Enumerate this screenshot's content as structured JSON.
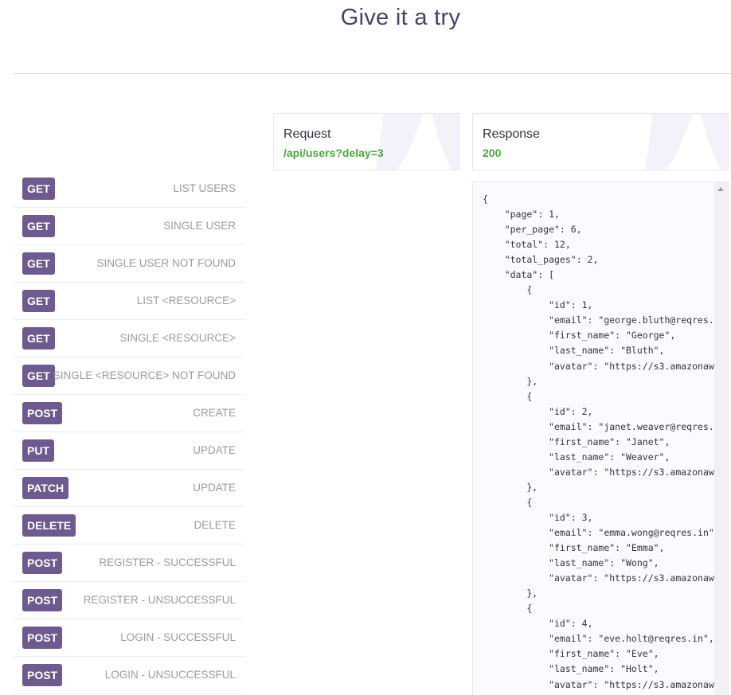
{
  "header": {
    "title": "Give it a try"
  },
  "endpoints": [
    {
      "method": "GET",
      "label": "LIST USERS"
    },
    {
      "method": "GET",
      "label": "SINGLE USER"
    },
    {
      "method": "GET",
      "label": "SINGLE USER NOT FOUND"
    },
    {
      "method": "GET",
      "label": "LIST <RESOURCE>"
    },
    {
      "method": "GET",
      "label": "SINGLE <RESOURCE>"
    },
    {
      "method": "GET",
      "label": "SINGLE <RESOURCE> NOT FOUND"
    },
    {
      "method": "POST",
      "label": "CREATE"
    },
    {
      "method": "PUT",
      "label": "UPDATE"
    },
    {
      "method": "PATCH",
      "label": "UPDATE"
    },
    {
      "method": "DELETE",
      "label": "DELETE"
    },
    {
      "method": "POST",
      "label": "REGISTER - SUCCESSFUL"
    },
    {
      "method": "POST",
      "label": "REGISTER - UNSUCCESSFUL"
    },
    {
      "method": "POST",
      "label": "LOGIN - SUCCESSFUL"
    },
    {
      "method": "POST",
      "label": "LOGIN - UNSUCCESSFUL"
    }
  ],
  "request": {
    "title": "Request",
    "url": "/api/users?delay=3"
  },
  "response": {
    "title": "Response",
    "status": "200",
    "body_lines": [
      "{",
      "    \"page\": 1,",
      "    \"per_page\": 6,",
      "    \"total\": 12,",
      "    \"total_pages\": 2,",
      "    \"data\": [",
      "        {",
      "            \"id\": 1,",
      "            \"email\": \"george.bluth@reqres.",
      "            \"first_name\": \"George\",",
      "            \"last_name\": \"Bluth\",",
      "            \"avatar\": \"https://s3.amazonaw",
      "        },",
      "        {",
      "            \"id\": 2,",
      "            \"email\": \"janet.weaver@reqres.",
      "            \"first_name\": \"Janet\",",
      "            \"last_name\": \"Weaver\",",
      "            \"avatar\": \"https://s3.amazonaw",
      "        },",
      "        {",
      "            \"id\": 3,",
      "            \"email\": \"emma.wong@reqres.in\"",
      "            \"first_name\": \"Emma\",",
      "            \"last_name\": \"Wong\",",
      "            \"avatar\": \"https://s3.amazonaw",
      "        },",
      "        {",
      "            \"id\": 4,",
      "            \"email\": \"eve.holt@reqres.in\",",
      "            \"first_name\": \"Eve\",",
      "            \"last_name\": \"Holt\",",
      "            \"avatar\": \"https://s3.amazonaw"
    ]
  },
  "colors": {
    "method_badge": "#6e5a8f",
    "status_ok": "#4aa83c",
    "title": "#4a3f6b"
  }
}
